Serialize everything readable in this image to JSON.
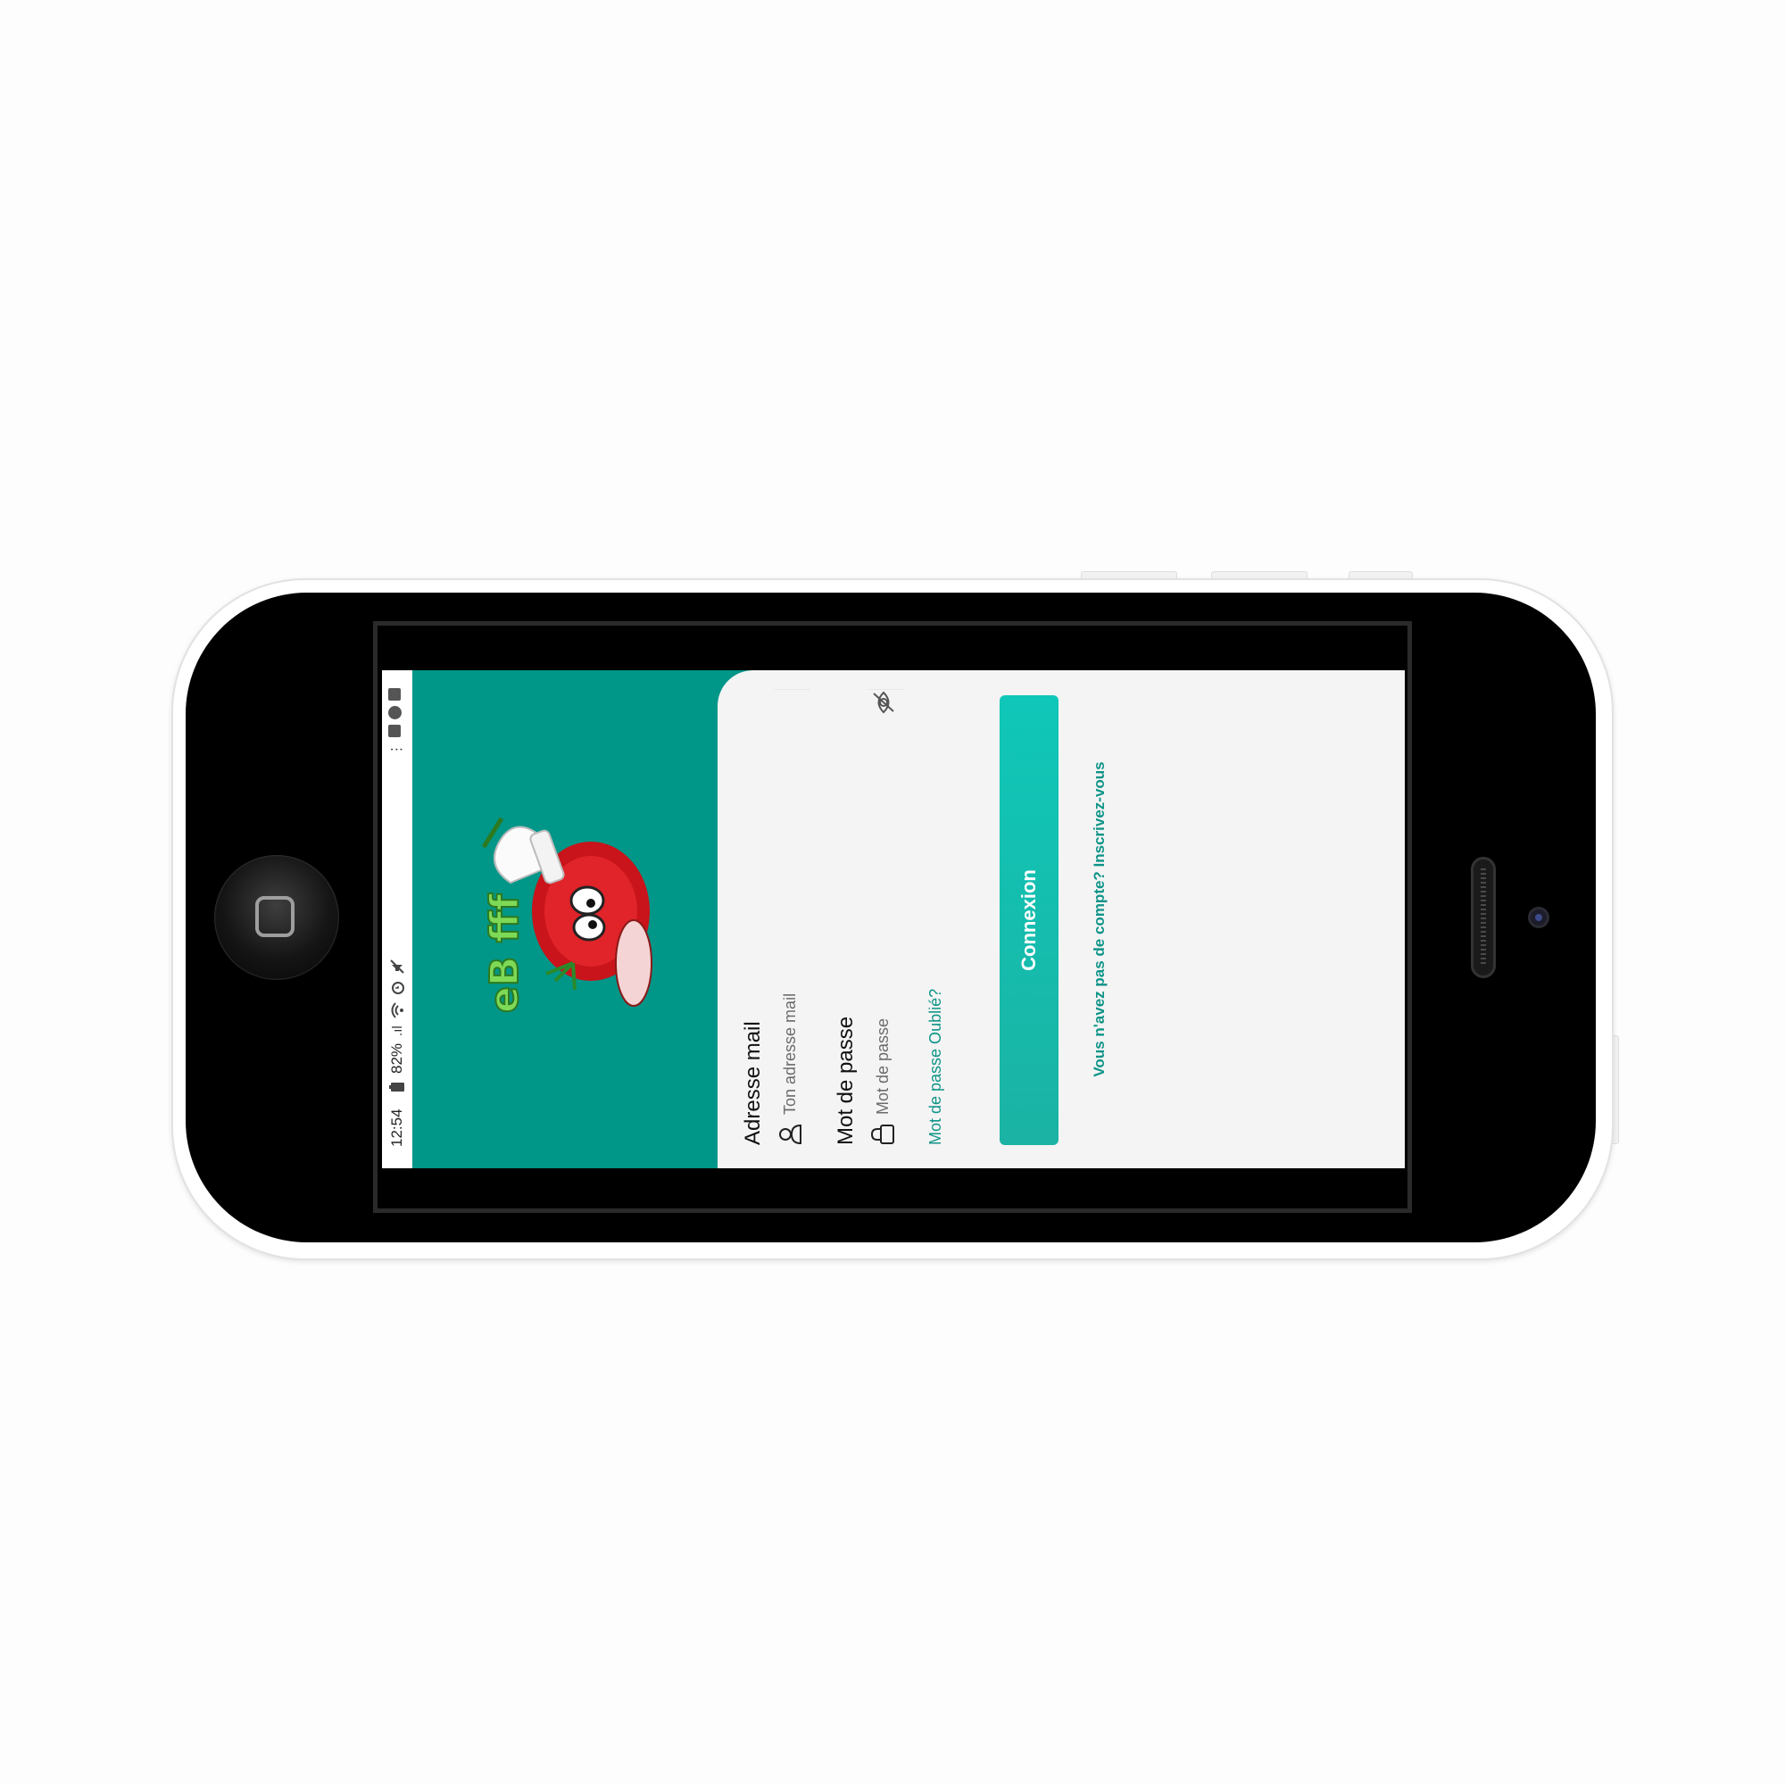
{
  "status_bar": {
    "time": "12:54",
    "battery": "82%",
    "signal_label": ".ıl",
    "icons_left": [
      "mute-icon",
      "alarm-icon",
      "wifi-icon",
      "signal-icon",
      "battery-icon"
    ],
    "icons_right": [
      "notification-icon",
      "notification-icon",
      "notification-icon",
      "more-icon"
    ]
  },
  "header": {
    "logo_text": "eB fff",
    "logo_icon": "chef-tomato-logo"
  },
  "login": {
    "email_label": "Adresse mail",
    "email_placeholder": "Ton adresse mail",
    "password_label": "Mot de passe",
    "password_placeholder": "Mot de passe",
    "forgot_password": "Mot de passe Oublié?",
    "submit_label": "Connexion",
    "signup_prompt": "Vous n'avez pas de compte? Inscrivez-vous"
  },
  "colors": {
    "header_teal": "#009688",
    "accent": "#0f9488",
    "button_start": "#1bb3a4",
    "button_end": "#0fc7b8",
    "card_bg": "#f4f4f4"
  }
}
